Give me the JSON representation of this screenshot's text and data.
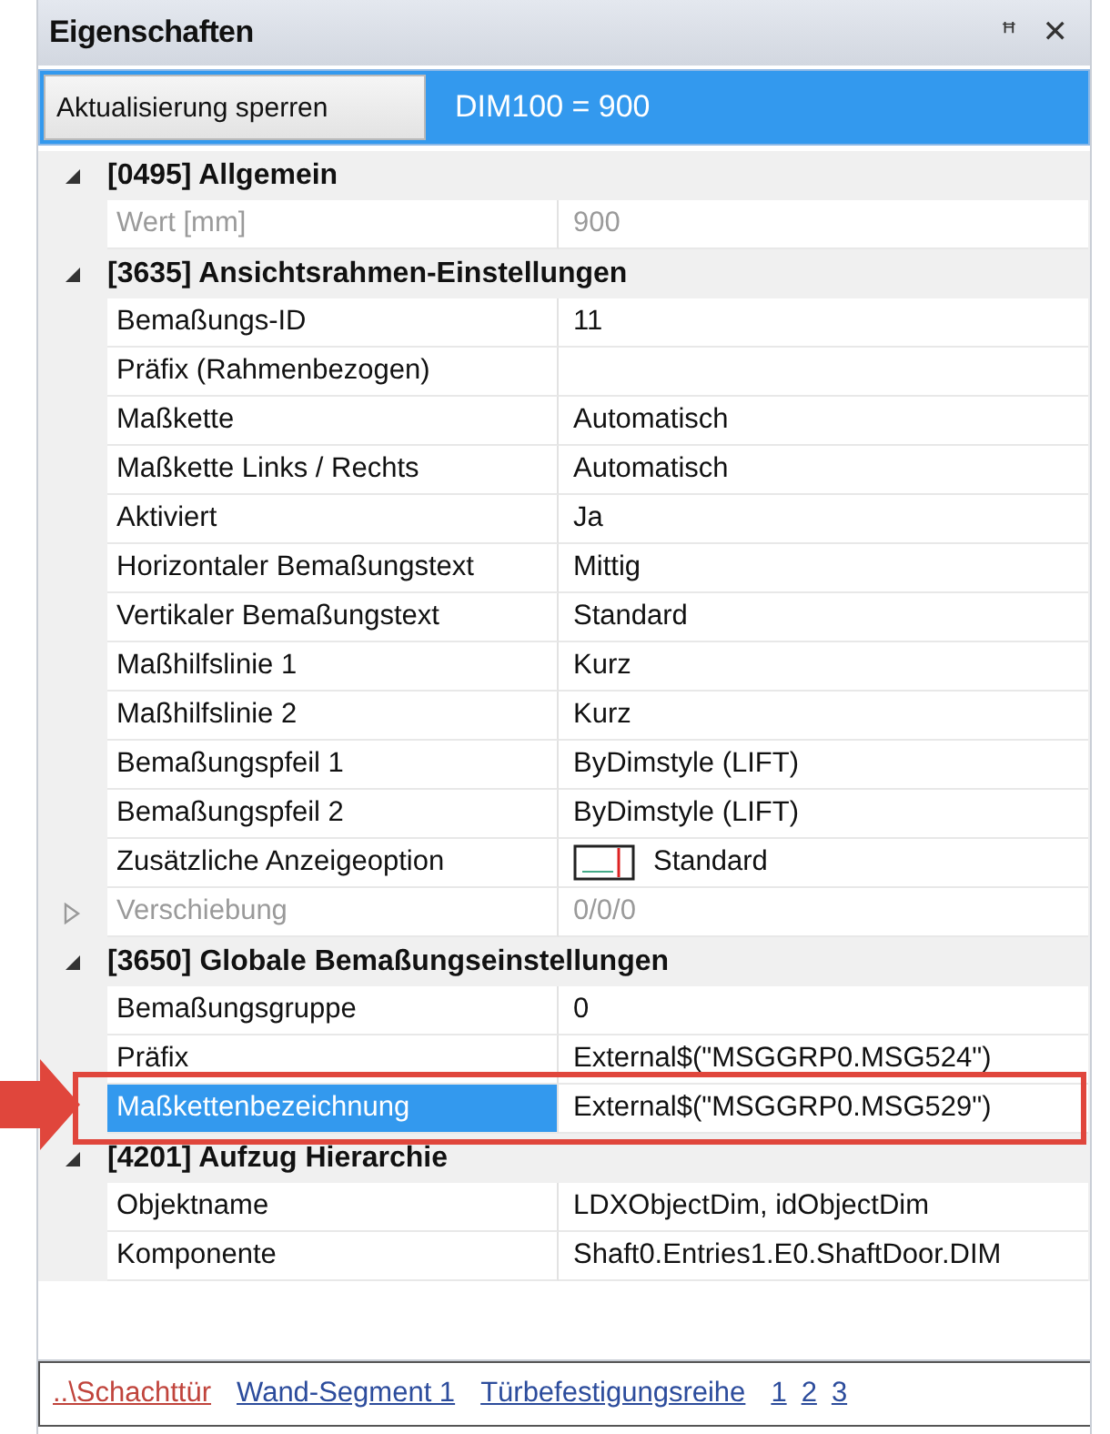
{
  "window": {
    "title": "Eigenschaften",
    "pin_glyph": "ꟸ",
    "close_glyph": "✕"
  },
  "toolbar": {
    "button": "Aktualisierung sperren",
    "value": "DIM100 = 900"
  },
  "groups": [
    {
      "title": "[0495] Allgemein",
      "expanded": true,
      "rows": [
        {
          "name": "Wert [mm]",
          "value": "900",
          "kind": "text",
          "disabled": true,
          "selected": false
        }
      ]
    },
    {
      "title": "[3635] Ansichtsrahmen-Einstellungen",
      "expanded": true,
      "rows": [
        {
          "name": "Bemaßungs-ID",
          "value": "11",
          "kind": "text",
          "disabled": false,
          "selected": false
        },
        {
          "name": "Präfix (Rahmenbezogen)",
          "kind": "text",
          "disabled": false,
          "selected": false
        },
        {
          "name": "Maßkette",
          "value": "Automatisch",
          "kind": "text",
          "disabled": false,
          "selected": false
        },
        {
          "name": "Maßkette Links / Rechts",
          "value": "Automatisch",
          "kind": "text",
          "disabled": false,
          "selected": false
        },
        {
          "name": "Aktiviert",
          "value": "Ja",
          "kind": "text",
          "disabled": false,
          "selected": false
        },
        {
          "name": "Horizontaler Bemaßungstext",
          "value": "Mittig",
          "kind": "text",
          "disabled": false,
          "selected": false
        },
        {
          "name": "Vertikaler Bemaßungstext",
          "value": "Standard",
          "kind": "text",
          "disabled": false,
          "selected": false
        },
        {
          "name": "Maßhilfslinie 1",
          "value": "Kurz",
          "kind": "text",
          "disabled": false,
          "selected": false
        },
        {
          "name": "Maßhilfslinie 2",
          "value": "Kurz",
          "kind": "text",
          "disabled": false,
          "selected": false
        },
        {
          "name": "Bemaßungspfeil 1",
          "value": "ByDimstyle (LIFT)",
          "kind": "text",
          "disabled": false,
          "selected": false
        },
        {
          "name": "Bemaßungspfeil 2",
          "value": "ByDimstyle (LIFT)",
          "kind": "text",
          "disabled": false,
          "selected": false
        },
        {
          "name": "Zusätzliche Anzeigeoption",
          "value": "Standard",
          "kind": "preview",
          "disabled": false,
          "selected": false
        },
        {
          "name": "Verschiebung",
          "value": "0/0/0",
          "kind": "expandable",
          "expanded": false,
          "disabled": true,
          "selected": false
        }
      ]
    },
    {
      "title": "[3650] Globale Bemaßungseinstellungen",
      "expanded": true,
      "rows": [
        {
          "name": "Bemaßungsgruppe",
          "value": "0",
          "kind": "text",
          "disabled": false,
          "selected": false
        },
        {
          "name": "Präfix",
          "value": "External$(\"MSGGRP0.MSG524\")",
          "kind": "text",
          "disabled": false,
          "selected": false
        },
        {
          "name": "Maßkettenbezeichnung",
          "value": "External$(\"MSGGRP0.MSG529\")",
          "kind": "text",
          "disabled": false,
          "selected": true
        }
      ]
    },
    {
      "title": "[4201] Aufzug Hierarchie",
      "expanded": true,
      "rows": [
        {
          "name": "Objektname",
          "value": "LDXObjectDim, idObjectDim",
          "kind": "text",
          "disabled": false,
          "selected": false
        },
        {
          "name": "Komponente",
          "value": "Shaft0.Entries1.E0.ShaftDoor.DIM",
          "kind": "text",
          "disabled": false,
          "selected": false
        }
      ]
    }
  ],
  "breadcrumbs": [
    {
      "label": "..\\Schachttür",
      "selected": true
    },
    {
      "label": "Wand-Segment 1",
      "selected": false
    },
    {
      "label": "Türbefestigungsreihe",
      "selected": false
    },
    {
      "label": "1",
      "selected": false
    },
    {
      "label": "2",
      "selected": false
    },
    {
      "label": "3",
      "selected": false
    }
  ]
}
